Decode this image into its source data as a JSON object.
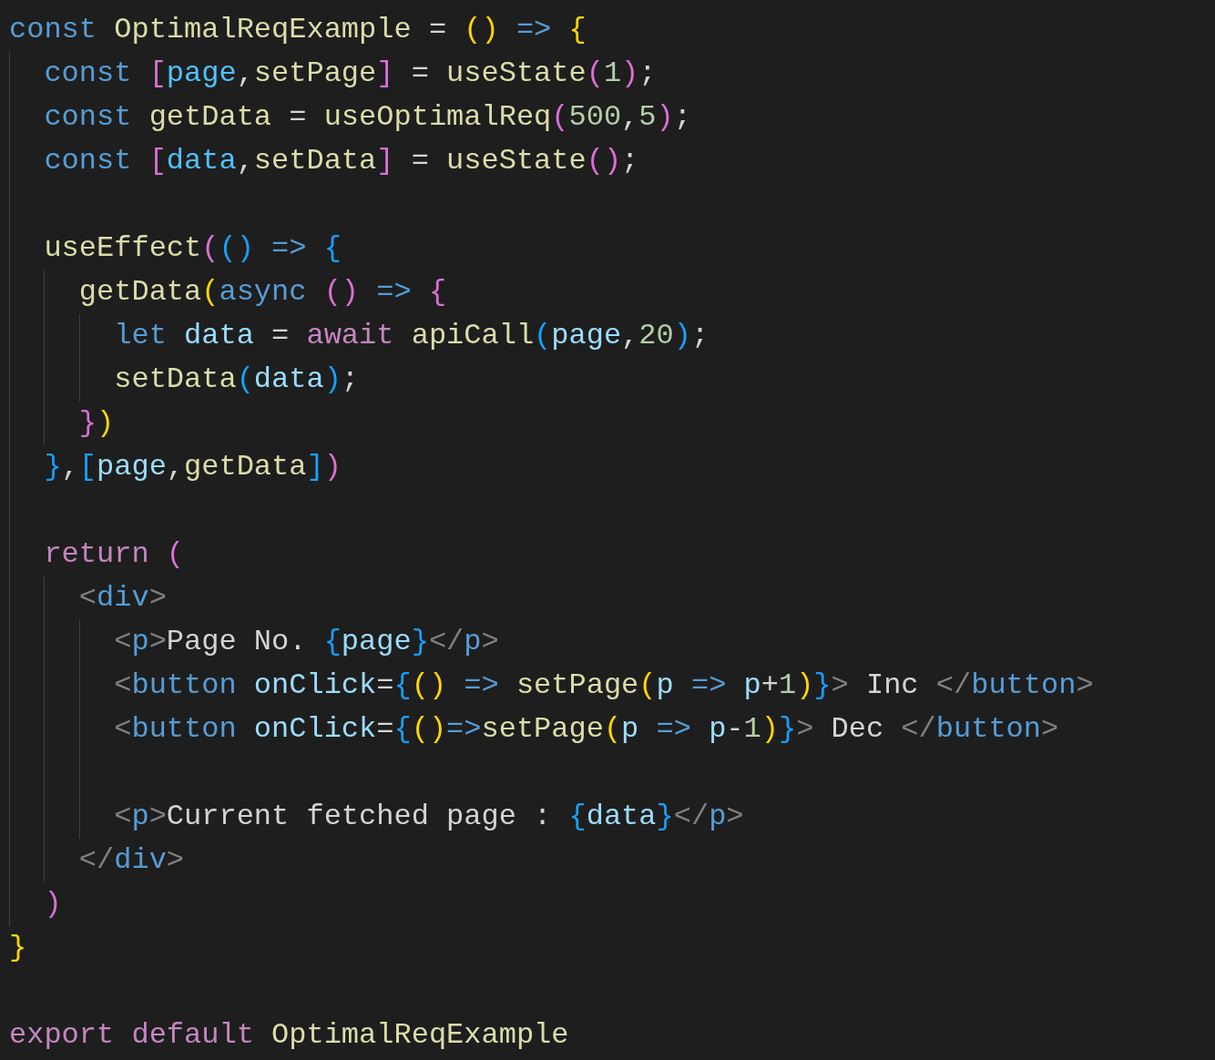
{
  "editor": {
    "lines": [
      {
        "tokens": [
          {
            "text": "const ",
            "color": "#569cd6"
          },
          {
            "text": "OptimalReqExample",
            "color": "#dcdcaa"
          },
          {
            "text": " = ",
            "color": "#d4d4d4"
          },
          {
            "text": "()",
            "color": "#ffd700"
          },
          {
            "text": " => ",
            "color": "#569cd6"
          },
          {
            "text": "{",
            "color": "#ffd700"
          }
        ]
      },
      {
        "guides": [
          {
            "kind": "indent-guide"
          }
        ],
        "tokens": [
          {
            "text": "const ",
            "color": "#569cd6"
          },
          {
            "text": "[",
            "color": "#da70d6"
          },
          {
            "text": "page",
            "color": "#4fc1ff"
          },
          {
            "text": ",",
            "color": "#d4d4d4"
          },
          {
            "text": "setPage",
            "color": "#dcdcaa"
          },
          {
            "text": "]",
            "color": "#da70d6"
          },
          {
            "text": " = ",
            "color": "#d4d4d4"
          },
          {
            "text": "useState",
            "color": "#dcdcaa"
          },
          {
            "text": "(",
            "color": "#da70d6"
          },
          {
            "text": "1",
            "color": "#b5cea8"
          },
          {
            "text": ")",
            "color": "#da70d6"
          },
          {
            "text": ";",
            "color": "#d4d4d4"
          }
        ]
      },
      {
        "guides": [
          {
            "kind": "indent-guide"
          }
        ],
        "tokens": [
          {
            "text": "const ",
            "color": "#569cd6"
          },
          {
            "text": "getData",
            "color": "#dcdcaa"
          },
          {
            "text": " = ",
            "color": "#d4d4d4"
          },
          {
            "text": "useOptimalReq",
            "color": "#dcdcaa"
          },
          {
            "text": "(",
            "color": "#da70d6"
          },
          {
            "text": "500",
            "color": "#b5cea8"
          },
          {
            "text": ",",
            "color": "#d4d4d4"
          },
          {
            "text": "5",
            "color": "#b5cea8"
          },
          {
            "text": ")",
            "color": "#da70d6"
          },
          {
            "text": ";",
            "color": "#d4d4d4"
          }
        ]
      },
      {
        "guides": [
          {
            "kind": "indent-guide"
          }
        ],
        "tokens": [
          {
            "text": "const ",
            "color": "#569cd6"
          },
          {
            "text": "[",
            "color": "#da70d6"
          },
          {
            "text": "data",
            "color": "#4fc1ff"
          },
          {
            "text": ",",
            "color": "#d4d4d4"
          },
          {
            "text": "setData",
            "color": "#dcdcaa"
          },
          {
            "text": "]",
            "color": "#da70d6"
          },
          {
            "text": " = ",
            "color": "#d4d4d4"
          },
          {
            "text": "useState",
            "color": "#dcdcaa"
          },
          {
            "text": "()",
            "color": "#da70d6"
          },
          {
            "text": ";",
            "color": "#d4d4d4"
          }
        ]
      },
      {
        "guides": [
          {
            "kind": "indent-guide"
          }
        ]
      },
      {
        "guides": [
          {
            "kind": "indent-guide"
          }
        ],
        "tokens": [
          {
            "text": "useEffect",
            "color": "#dcdcaa"
          },
          {
            "text": "(",
            "color": "#da70d6"
          },
          {
            "text": "()",
            "color": "#179fff"
          },
          {
            "text": " => ",
            "color": "#569cd6"
          },
          {
            "text": "{",
            "color": "#179fff"
          }
        ]
      },
      {
        "guides": [
          {
            "kind": "indent-guide"
          },
          {
            "kind": "indent-guide"
          }
        ],
        "tokens": [
          {
            "text": "getData",
            "color": "#dcdcaa"
          },
          {
            "text": "(",
            "color": "#ffd700"
          },
          {
            "text": "async ",
            "color": "#569cd6"
          },
          {
            "text": "()",
            "color": "#da70d6"
          },
          {
            "text": " => ",
            "color": "#569cd6"
          },
          {
            "text": "{",
            "color": "#da70d6"
          }
        ]
      },
      {
        "guides": [
          {
            "kind": "indent-guide"
          },
          {
            "kind": "indent-guide"
          },
          {
            "kind": "indent-guide"
          }
        ],
        "tokens": [
          {
            "text": "let ",
            "color": "#569cd6"
          },
          {
            "text": "data",
            "color": "#9cdcfe"
          },
          {
            "text": " = ",
            "color": "#d4d4d4"
          },
          {
            "text": "await ",
            "color": "#c586c0"
          },
          {
            "text": "apiCall",
            "color": "#dcdcaa"
          },
          {
            "text": "(",
            "color": "#179fff"
          },
          {
            "text": "page",
            "color": "#9cdcfe"
          },
          {
            "text": ",",
            "color": "#d4d4d4"
          },
          {
            "text": "20",
            "color": "#b5cea8"
          },
          {
            "text": ")",
            "color": "#179fff"
          },
          {
            "text": ";",
            "color": "#d4d4d4"
          }
        ]
      },
      {
        "guides": [
          {
            "kind": "indent-guide"
          },
          {
            "kind": "indent-guide"
          },
          {
            "kind": "indent-guide"
          }
        ],
        "tokens": [
          {
            "text": "setData",
            "color": "#dcdcaa"
          },
          {
            "text": "(",
            "color": "#179fff"
          },
          {
            "text": "data",
            "color": "#9cdcfe"
          },
          {
            "text": ")",
            "color": "#179fff"
          },
          {
            "text": ";",
            "color": "#d4d4d4"
          }
        ]
      },
      {
        "guides": [
          {
            "kind": "indent-guide"
          },
          {
            "kind": "indent-guide"
          }
        ],
        "tokens": [
          {
            "text": "}",
            "color": "#da70d6"
          },
          {
            "text": ")",
            "color": "#ffd700"
          }
        ]
      },
      {
        "guides": [
          {
            "kind": "indent-guide"
          }
        ],
        "tokens": [
          {
            "text": "}",
            "color": "#179fff"
          },
          {
            "text": ",",
            "color": "#d4d4d4"
          },
          {
            "text": "[",
            "color": "#179fff"
          },
          {
            "text": "page",
            "color": "#9cdcfe"
          },
          {
            "text": ",",
            "color": "#d4d4d4"
          },
          {
            "text": "getData",
            "color": "#dcdcaa"
          },
          {
            "text": "]",
            "color": "#179fff"
          },
          {
            "text": ")",
            "color": "#da70d6"
          }
        ]
      },
      {
        "guides": [
          {
            "kind": "indent-guide"
          }
        ]
      },
      {
        "guides": [
          {
            "kind": "indent-guide"
          }
        ],
        "tokens": [
          {
            "text": "return ",
            "color": "#c586c0"
          },
          {
            "text": "(",
            "color": "#da70d6"
          }
        ]
      },
      {
        "guides": [
          {
            "kind": "indent-guide"
          },
          {
            "kind": "indent-guide"
          }
        ],
        "tokens": [
          {
            "text": "<",
            "color": "#808080"
          },
          {
            "text": "div",
            "color": "#569cd6"
          },
          {
            "text": ">",
            "color": "#808080"
          }
        ]
      },
      {
        "guides": [
          {
            "kind": "indent-guide"
          },
          {
            "kind": "indent-guide"
          },
          {
            "kind": "indent-guide"
          }
        ],
        "tokens": [
          {
            "text": "<",
            "color": "#808080"
          },
          {
            "text": "p",
            "color": "#569cd6"
          },
          {
            "text": ">",
            "color": "#808080"
          },
          {
            "text": "Page No. ",
            "color": "#d4d4d4"
          },
          {
            "text": "{",
            "color": "#179fff"
          },
          {
            "text": "page",
            "color": "#9cdcfe"
          },
          {
            "text": "}",
            "color": "#179fff"
          },
          {
            "text": "</",
            "color": "#808080"
          },
          {
            "text": "p",
            "color": "#569cd6"
          },
          {
            "text": ">",
            "color": "#808080"
          }
        ]
      },
      {
        "guides": [
          {
            "kind": "indent-guide"
          },
          {
            "kind": "indent-guide"
          },
          {
            "kind": "indent-guide"
          }
        ],
        "tokens": [
          {
            "text": "<",
            "color": "#808080"
          },
          {
            "text": "button ",
            "color": "#569cd6"
          },
          {
            "text": "onClick",
            "color": "#9cdcfe"
          },
          {
            "text": "=",
            "color": "#d4d4d4"
          },
          {
            "text": "{",
            "color": "#179fff"
          },
          {
            "text": "()",
            "color": "#ffd700"
          },
          {
            "text": " => ",
            "color": "#569cd6"
          },
          {
            "text": "setPage",
            "color": "#dcdcaa"
          },
          {
            "text": "(",
            "color": "#ffd700"
          },
          {
            "text": "p",
            "color": "#9cdcfe"
          },
          {
            "text": " => ",
            "color": "#569cd6"
          },
          {
            "text": "p",
            "color": "#9cdcfe"
          },
          {
            "text": "+",
            "color": "#d4d4d4"
          },
          {
            "text": "1",
            "color": "#b5cea8"
          },
          {
            "text": ")",
            "color": "#ffd700"
          },
          {
            "text": "}",
            "color": "#179fff"
          },
          {
            "text": ">",
            "color": "#808080"
          },
          {
            "text": " Inc ",
            "color": "#d4d4d4"
          },
          {
            "text": "</",
            "color": "#808080"
          },
          {
            "text": "button",
            "color": "#569cd6"
          },
          {
            "text": ">",
            "color": "#808080"
          }
        ]
      },
      {
        "guides": [
          {
            "kind": "indent-guide"
          },
          {
            "kind": "indent-guide"
          },
          {
            "kind": "indent-guide"
          }
        ],
        "tokens": [
          {
            "text": "<",
            "color": "#808080"
          },
          {
            "text": "button ",
            "color": "#569cd6"
          },
          {
            "text": "onClick",
            "color": "#9cdcfe"
          },
          {
            "text": "=",
            "color": "#d4d4d4"
          },
          {
            "text": "{",
            "color": "#179fff"
          },
          {
            "text": "()",
            "color": "#ffd700"
          },
          {
            "text": "=>",
            "color": "#569cd6"
          },
          {
            "text": "setPage",
            "color": "#dcdcaa"
          },
          {
            "text": "(",
            "color": "#ffd700"
          },
          {
            "text": "p",
            "color": "#9cdcfe"
          },
          {
            "text": " => ",
            "color": "#569cd6"
          },
          {
            "text": "p",
            "color": "#9cdcfe"
          },
          {
            "text": "-",
            "color": "#d4d4d4"
          },
          {
            "text": "1",
            "color": "#b5cea8"
          },
          {
            "text": ")",
            "color": "#ffd700"
          },
          {
            "text": "}",
            "color": "#179fff"
          },
          {
            "text": ">",
            "color": "#808080"
          },
          {
            "text": " Dec ",
            "color": "#d4d4d4"
          },
          {
            "text": "</",
            "color": "#808080"
          },
          {
            "text": "button",
            "color": "#569cd6"
          },
          {
            "text": ">",
            "color": "#808080"
          }
        ]
      },
      {
        "guides": [
          {
            "kind": "indent-guide"
          },
          {
            "kind": "indent-guide"
          },
          {
            "kind": "indent-guide"
          }
        ]
      },
      {
        "guides": [
          {
            "kind": "indent-guide"
          },
          {
            "kind": "indent-guide"
          },
          {
            "kind": "indent-guide"
          }
        ],
        "tokens": [
          {
            "text": "<",
            "color": "#808080"
          },
          {
            "text": "p",
            "color": "#569cd6"
          },
          {
            "text": ">",
            "color": "#808080"
          },
          {
            "text": "Current fetched page : ",
            "color": "#d4d4d4"
          },
          {
            "text": "{",
            "color": "#179fff"
          },
          {
            "text": "data",
            "color": "#9cdcfe"
          },
          {
            "text": "}",
            "color": "#179fff"
          },
          {
            "text": "</",
            "color": "#808080"
          },
          {
            "text": "p",
            "color": "#569cd6"
          },
          {
            "text": ">",
            "color": "#808080"
          }
        ]
      },
      {
        "guides": [
          {
            "kind": "indent-guide"
          },
          {
            "kind": "indent-guide"
          }
        ],
        "tokens": [
          {
            "text": "</",
            "color": "#808080"
          },
          {
            "text": "div",
            "color": "#569cd6"
          },
          {
            "text": ">",
            "color": "#808080"
          }
        ]
      },
      {
        "guides": [
          {
            "kind": "indent-guide"
          }
        ],
        "tokens": [
          {
            "text": ")",
            "color": "#da70d6"
          }
        ]
      },
      {
        "tokens": [
          {
            "text": "}",
            "color": "#ffd700"
          }
        ]
      },
      {
        "kind": "blank"
      },
      {
        "tokens": [
          {
            "text": "export default ",
            "color": "#c586c0"
          },
          {
            "text": "OptimalReqExample",
            "color": "#dcdcaa"
          }
        ]
      }
    ]
  }
}
